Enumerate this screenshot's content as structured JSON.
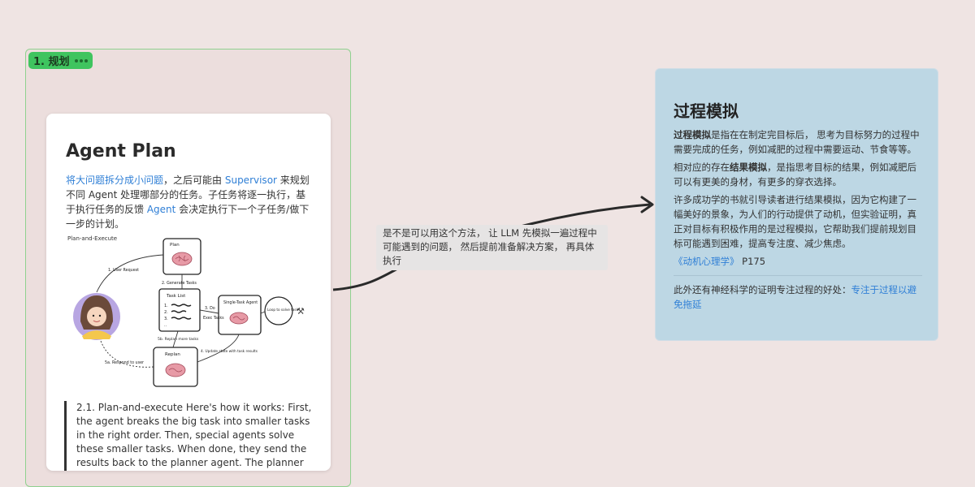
{
  "frame": {
    "tag_label": "1. 规划"
  },
  "plan_card": {
    "title": "Agent Plan",
    "intro": {
      "link1": "将大问题拆分成小问题",
      "text1": "，之后可能由 ",
      "link2": "Supervisor",
      "text2": " 来规划不同 Agent 处理哪部分的任务。子任务将逐一执行，基于执行任务的反馈 ",
      "link3": "Agent",
      "text3": " 会决定执行下一个子任务/做下一步的计划。"
    },
    "diagram": {
      "title": "Plan-and-Execute",
      "boxes": [
        "Plan",
        "Task List",
        "Single-Task Agent",
        "Replan",
        "Loop to solve task"
      ],
      "arrows": [
        "1. User Request",
        "2. Generate Tasks",
        "3. Do",
        "Exec Tasks",
        "4. Update state with task results",
        "5b. Replan more tasks",
        "5a. Respond to user"
      ],
      "list_marks": [
        "1.",
        "2.",
        "3.",
        ".."
      ]
    },
    "quote": "2.1. Plan-and-execute Here's how it works: First, the agent breaks the big task into smaller tasks in the right order. Then, special agents solve these smaller tasks. When done, they send the results back to the planner agent. The planner agent"
  },
  "comment": {
    "text": "是不是可以用这个方法， 让 LLM 先模拟一遍过程中可能遇到的问题， 然后提前准备解决方案， 再具体执行"
  },
  "sim_card": {
    "title": "过程模拟",
    "p1_bold": "过程模拟",
    "p1_rest": "是指在在制定完目标后， 思考为目标努力的过程中需要完成的任务，例如减肥的过程中需要运动、节食等等。",
    "p2_pre": "相对应的存在",
    "p2_bold": "结果模拟",
    "p2_rest": "，是指思考目标的结果，例如减肥后可以有更美的身材，有更多的穿衣选择。",
    "p3": "许多成功学的书就引导读者进行结果模拟，因为它构建了一幅美好的景象，为人们的行动提供了动机，但实验证明，真正对目标有积极作用的是过程模拟，它帮助我们提前规划目标可能遇到困难，提高专注度、减少焦虑。",
    "ref_link": "《动机心理学》",
    "ref_page": " P175",
    "footer_text": "此外还有神经科学的证明专注过程的好处：",
    "footer_link": "专注于过程以避免拖延"
  },
  "colors": {
    "background": "#efe4e3",
    "frame_border": "#8fd18f",
    "tag": "#3fc45f",
    "link": "#2f7fd6",
    "sim_card": "#bdd7e4"
  }
}
